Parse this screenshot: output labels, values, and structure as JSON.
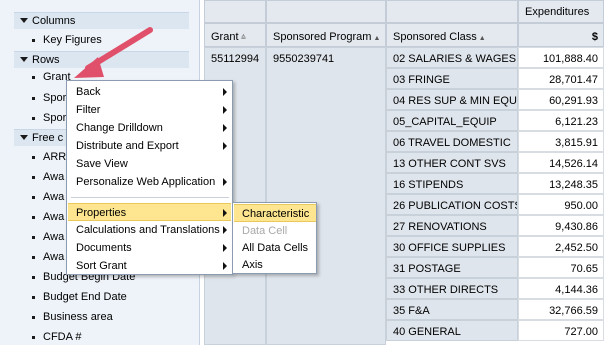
{
  "nav": {
    "sections": [
      {
        "label": "Columns"
      },
      {
        "label": "Rows"
      },
      {
        "label": "Free c"
      }
    ],
    "columns_items": [
      "Key Figures"
    ],
    "rows_items": [
      "Grant",
      "Spor",
      "Spor"
    ],
    "free_items": [
      "ARR",
      "Awa",
      "Awa",
      "Awa",
      "Awa",
      "Awa",
      "Budget Begin Date",
      "Budget End Date",
      "Business area",
      "CFDA #"
    ]
  },
  "grid": {
    "headers": {
      "grant": "Grant",
      "program": "Sponsored Program",
      "class": "Sponsored Class",
      "expenditures": "Expenditures",
      "currency": "$"
    },
    "row_grant": "55112994",
    "row_program": "9550239741",
    "rows": [
      {
        "class": "02 SALARIES & WAGES",
        "value": "101,888.40"
      },
      {
        "class": "03 FRINGE",
        "value": "28,701.47"
      },
      {
        "class": "04 RES SUP & MIN EQU",
        "value": "60,291.93"
      },
      {
        "class": "05_CAPITAL_EQUIP",
        "value": "6,121.23"
      },
      {
        "class": "06 TRAVEL DOMESTIC",
        "value": "3,815.91"
      },
      {
        "class": "13 OTHER CONT SVS",
        "value": "14,526.14"
      },
      {
        "class": "16 STIPENDS",
        "value": "13,248.35"
      },
      {
        "class": "26 PUBLICATION COSTS",
        "value": "950.00"
      },
      {
        "class": "27 RENOVATIONS",
        "value": "9,430.86"
      },
      {
        "class": "30 OFFICE SUPPLIES",
        "value": "2,452.50"
      },
      {
        "class": "31 POSTAGE",
        "value": "70.65"
      },
      {
        "class": "33 OTHER DIRECTS",
        "value": "4,144.36"
      },
      {
        "class": "35 F&A",
        "value": "32,766.59"
      },
      {
        "class": "40 GENERAL",
        "value": "727.00"
      }
    ]
  },
  "context_menu": {
    "items": [
      {
        "label": "Back",
        "has_submenu": true
      },
      {
        "label": "Filter",
        "has_submenu": true
      },
      {
        "label": "Change Drilldown",
        "has_submenu": true
      },
      {
        "label": "Distribute and Export",
        "has_submenu": true
      },
      {
        "label": "Save View",
        "has_submenu": false
      },
      {
        "label": "Personalize Web Application",
        "has_submenu": true
      },
      {
        "label": "Properties",
        "has_submenu": true,
        "highlighted": true
      },
      {
        "label": "Calculations and Translations",
        "has_submenu": true
      },
      {
        "label": "Documents",
        "has_submenu": true
      },
      {
        "label": "Sort Grant",
        "has_submenu": true
      }
    ]
  },
  "submenu": {
    "items": [
      {
        "label": "Characteristic",
        "highlighted": true
      },
      {
        "label": "Data Cell",
        "disabled": true
      },
      {
        "label": "All Data Cells"
      },
      {
        "label": "Axis"
      }
    ]
  },
  "colors": {
    "highlight": "#fde68f",
    "nav_bg": "#eef3f9",
    "section_bg": "#dce6f1",
    "arrow": "#e0506a"
  }
}
